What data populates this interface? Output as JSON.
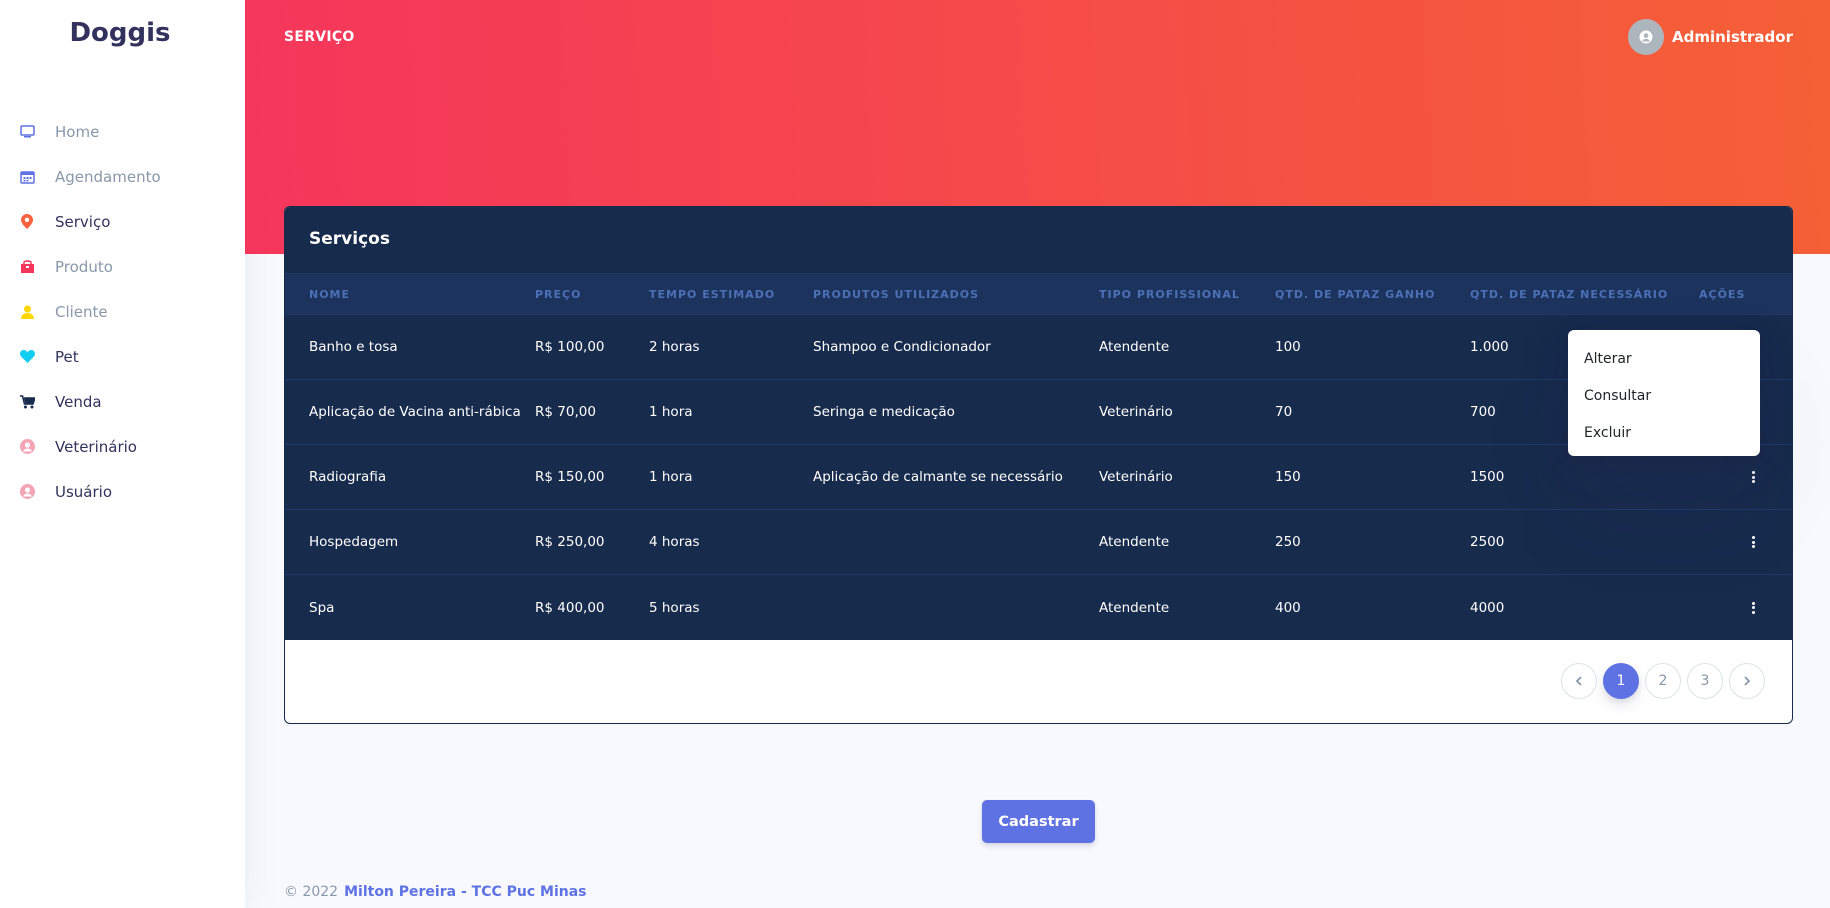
{
  "app": {
    "brand": "Doggis"
  },
  "sidebar": {
    "items": [
      {
        "label": "Home",
        "icon": "tv-icon",
        "color": "#5e72e4",
        "active": false
      },
      {
        "label": "Agendamento",
        "icon": "calendar-icon",
        "color": "#5e72e4",
        "active": false
      },
      {
        "label": "Serviço",
        "icon": "pin-icon",
        "color": "#fb6340",
        "active": true
      },
      {
        "label": "Produto",
        "icon": "box-icon",
        "color": "#f5365c",
        "active": false
      },
      {
        "label": "Cliente",
        "icon": "user-icon",
        "color": "#ffd600",
        "active": false
      },
      {
        "label": "Pet",
        "icon": "heart-icon",
        "color": "#11cdef",
        "active": true
      },
      {
        "label": "Venda",
        "icon": "cart-icon",
        "color": "#172b4d",
        "active": true
      },
      {
        "label": "Veterinário",
        "icon": "user-circle-icon",
        "color": "#f3a4b5",
        "active": true
      },
      {
        "label": "Usuário",
        "icon": "user-circle-icon",
        "color": "#f3a4b5",
        "active": true
      }
    ]
  },
  "header": {
    "title": "SERVIÇO",
    "user_name": "Administrador"
  },
  "card": {
    "title": "Serviços",
    "columns": [
      "Nome",
      "Preço",
      "Tempo Estimado",
      "Produtos Utilizados",
      "Tipo Profissional",
      "Qtd. de Pataz Ganho",
      "Qtd. de Pataz Necessário",
      "Ações"
    ],
    "rows": [
      [
        "Banho e tosa",
        "R$ 100,00",
        "2 horas",
        "Shampoo e Condicionador",
        "Atendente",
        "100",
        "1.000"
      ],
      [
        "Aplicação de Vacina anti-rábica",
        "R$ 70,00",
        "1 hora",
        "Seringa e medicação",
        "Veterinário",
        "70",
        "700"
      ],
      [
        "Radiografia",
        "R$ 150,00",
        "1 hora",
        "Aplicação de calmante se necessário",
        "Veterinário",
        "150",
        "1500"
      ],
      [
        "Hospedagem",
        "R$ 250,00",
        "4 horas",
        "",
        "Atendente",
        "250",
        "2500"
      ],
      [
        "Spa",
        "R$ 400,00",
        "5 horas",
        "",
        "Atendente",
        "400",
        "4000"
      ]
    ]
  },
  "dropdown": {
    "items": [
      "Alterar",
      "Consultar",
      "Excluir"
    ]
  },
  "pagination": {
    "pages": [
      "1",
      "2",
      "3"
    ],
    "current": "1"
  },
  "actions": {
    "register_label": "Cadastrar"
  },
  "footer": {
    "copyright": "© 2022",
    "author": "Milton Pereira - TCC Puc Minas"
  },
  "colors": {
    "primary": "#5e72e4",
    "table_bg": "#172b4d",
    "header_gradient_start": "#f5365c",
    "header_gradient_end": "#f56036"
  }
}
